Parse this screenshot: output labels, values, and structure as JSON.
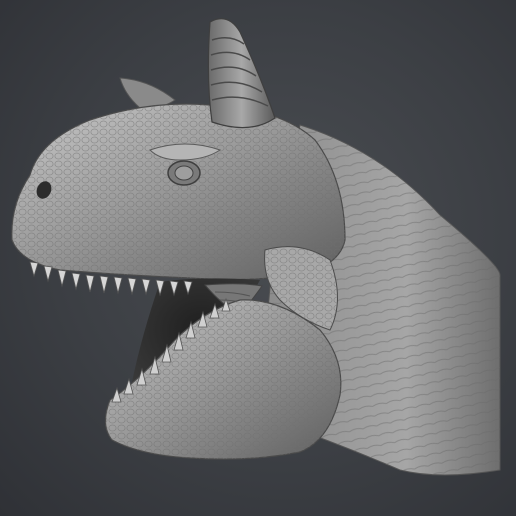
{
  "scene": {
    "subject_icon": "dinosaur-head-sculpt-icon",
    "colors": {
      "background": "#3c3f44",
      "background_dark": "#2f3136",
      "clay": "#9a9a9a",
      "clay_light": "#c8c8c8",
      "clay_dark": "#4a4a4a",
      "mouth_interior": "#2a2a2a"
    }
  }
}
